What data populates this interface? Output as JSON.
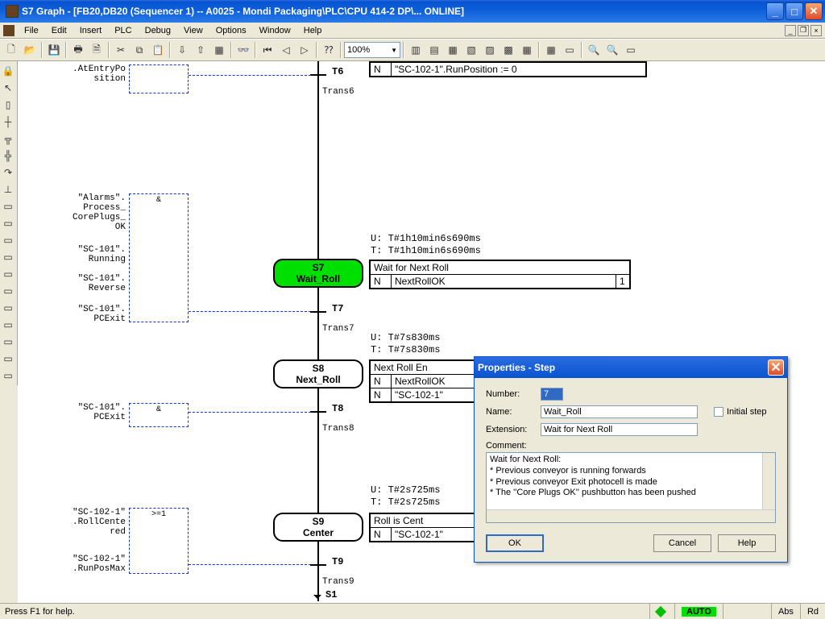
{
  "window": {
    "title": "S7 Graph - [FB20,DB20 (Sequencer 1) -- A0025 - Mondi Packaging\\PLC\\CPU 414-2 DP\\...  ONLINE]"
  },
  "menu": [
    "File",
    "Edit",
    "Insert",
    "PLC",
    "Debug",
    "View",
    "Options",
    "Window",
    "Help"
  ],
  "zoom": "100%",
  "signals": {
    "t6": ".AtEntryPo\nsition",
    "s7a": "\"Alarms\".\nProcess_\nCorePlugs_\nOK",
    "s7b": "\"SC-101\".\nRunning",
    "s7c": "\"SC-101\".\nReverse",
    "s7d": "\"SC-101\".\nPCExit",
    "t8": "\"SC-101\".\nPCExit",
    "s9a": "\"SC-102-1\"\n.RollCente\nred",
    "s9b": "\"SC-102-1\"\n.RunPosMax"
  },
  "ops": {
    "and": "&",
    "ge1": ">=1"
  },
  "steps": {
    "t6": {
      "lbl": "T6",
      "sub": "Trans6"
    },
    "s7": {
      "lbl": "S7",
      "name": "Wait_Roll"
    },
    "t7": {
      "lbl": "T7",
      "sub": "Trans7"
    },
    "s8": {
      "lbl": "S8",
      "name": "Next_Roll"
    },
    "t8": {
      "lbl": "T8",
      "sub": "Trans8"
    },
    "s9": {
      "lbl": "S9",
      "name": "Center"
    },
    "t9": {
      "lbl": "T9",
      "sub": "Trans9"
    },
    "s1": "S1"
  },
  "actions": {
    "t6": {
      "n": "N",
      "code": "\"SC-102-1\".RunPosition := 0"
    },
    "s7": {
      "u": "U: T#1h10min6s690ms",
      "t": "T: T#1h10min6s690ms",
      "hdr": "Wait for Next Roll",
      "n": "N",
      "code": "NextRollOK",
      "num": "1"
    },
    "s8": {
      "u": "U: T#7s830ms",
      "t": "T: T#7s830ms",
      "hdr": "Next Roll En",
      "r1n": "N",
      "r1c": "NextRollOK",
      "r2n": "N",
      "r2c": "\"SC-102-1\""
    },
    "s9": {
      "u": "U: T#2s725ms",
      "t": "T: T#2s725ms",
      "hdr": "Roll is Cent",
      "n": "N",
      "code": "\"SC-102-1\""
    }
  },
  "dialog": {
    "title": "Properties - Step",
    "number_lbl": "Number:",
    "number_val": "7",
    "name_lbl": "Name:",
    "name_val": "Wait_Roll",
    "initial": "Initial step",
    "ext_lbl": "Extension:",
    "ext_val": "Wait for Next Roll",
    "comment_lbl": "Comment:",
    "comment_lines": [
      "Wait for Next Roll:",
      "* Previous conveyor is running forwards",
      "* Previous conveyor Exit photocell is made",
      "* The ''Core Plugs OK'' pushbutton has been pushed"
    ],
    "ok": "OK",
    "cancel": "Cancel",
    "help": "Help"
  },
  "status": {
    "hint": "Press F1 for help.",
    "auto": "AUTO",
    "abs": "Abs",
    "rd": "Rd"
  }
}
